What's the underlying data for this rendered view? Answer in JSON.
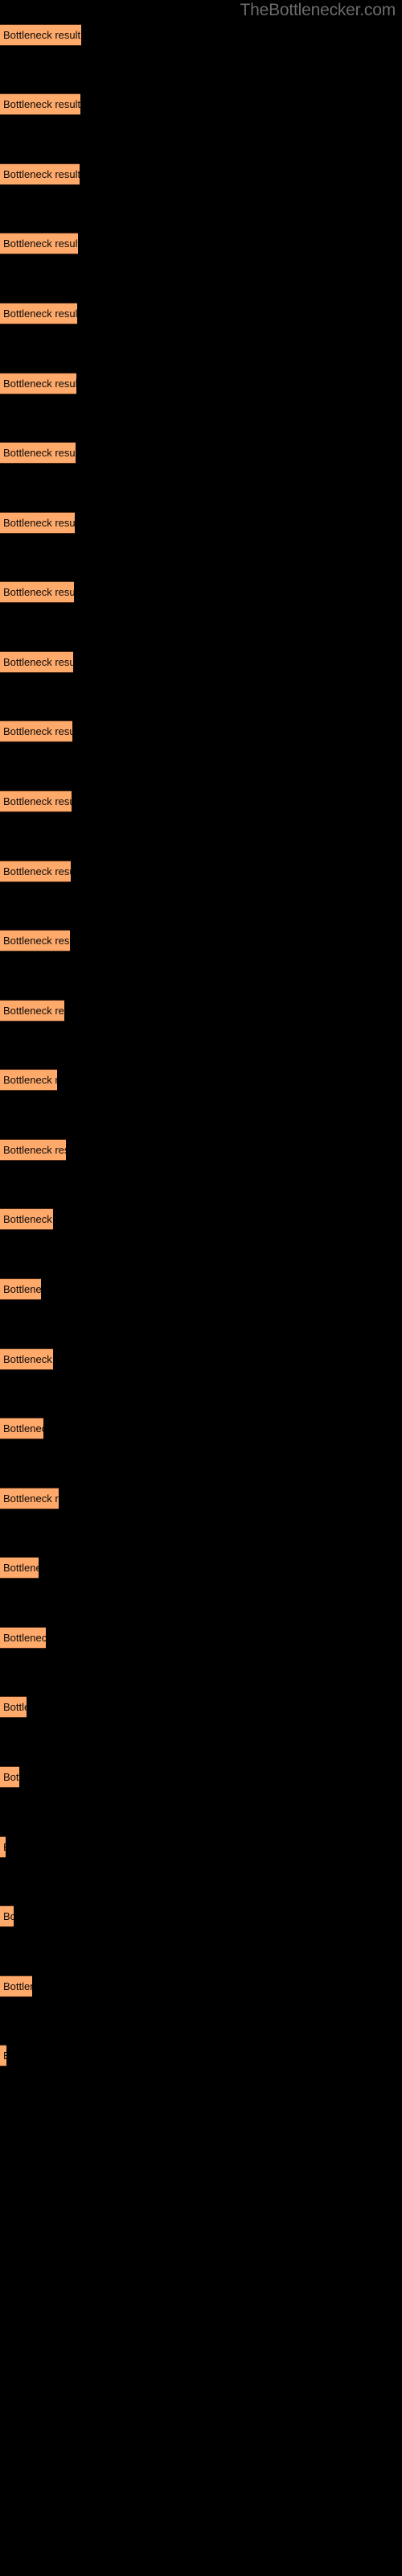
{
  "watermark": "TheBottlenecker.com",
  "colors": {
    "background": "#000000",
    "bar_fill": "#ffa96a",
    "bar_edge": "#4a2a16",
    "label_text": "#0a0a0a",
    "watermark_text": "#6b6b6b"
  },
  "chart_data": {
    "type": "bar",
    "orientation": "horizontal",
    "title": "",
    "subtitle": "",
    "xlabel": "",
    "ylabel": "",
    "grid": false,
    "legend": null,
    "bar_label_text": "Bottleneck result",
    "xlim": [
      0,
      500
    ],
    "categories": [
      "Bottleneck result",
      "Bottleneck result",
      "Bottleneck result",
      "Bottleneck result",
      "Bottleneck result",
      "Bottleneck result",
      "Bottleneck result",
      "Bottleneck result",
      "Bottleneck result",
      "Bottleneck result",
      "Bottleneck result",
      "Bottleneck result",
      "Bottleneck result",
      "Bottleneck result",
      "Bottleneck result",
      "Bottleneck result",
      "Bottleneck result",
      "Bottleneck result",
      "Bottleneck result",
      "Bottleneck result",
      "Bottleneck result",
      "Bottleneck result",
      "Bottleneck result",
      "Bottleneck result",
      "Bottleneck result",
      "Bottleneck result",
      "Bottleneck result",
      "Bottleneck result",
      "Bottleneck result",
      "Bottleneck result"
    ],
    "values": [
      101,
      100,
      99,
      97,
      96,
      95,
      94,
      93,
      92,
      91,
      90,
      89,
      88,
      87,
      80,
      71,
      82,
      66,
      51,
      66,
      54,
      73,
      48,
      57,
      33,
      24,
      7,
      17,
      40,
      8
    ],
    "bars": [
      {
        "label": "Bottleneck result",
        "value": 101,
        "y": 30
      },
      {
        "label": "Bottleneck result",
        "value": 100,
        "y": 116
      },
      {
        "label": "Bottleneck result",
        "value": 99,
        "y": 203
      },
      {
        "label": "Bottleneck result",
        "value": 97,
        "y": 289
      },
      {
        "label": "Bottleneck result",
        "value": 96,
        "y": 376
      },
      {
        "label": "Bottleneck result",
        "value": 95,
        "y": 463
      },
      {
        "label": "Bottleneck result",
        "value": 94,
        "y": 549
      },
      {
        "label": "Bottleneck result",
        "value": 93,
        "y": 636
      },
      {
        "label": "Bottleneck result",
        "value": 92,
        "y": 722
      },
      {
        "label": "Bottleneck result",
        "value": 91,
        "y": 809
      },
      {
        "label": "Bottleneck result",
        "value": 90,
        "y": 895
      },
      {
        "label": "Bottleneck result",
        "value": 89,
        "y": 982
      },
      {
        "label": "Bottleneck result",
        "value": 88,
        "y": 1069
      },
      {
        "label": "Bottleneck result",
        "value": 87,
        "y": 1155
      },
      {
        "label": "Bottleneck result",
        "value": 80,
        "y": 1242
      },
      {
        "label": "Bottleneck result",
        "value": 71,
        "y": 1328
      },
      {
        "label": "Bottleneck result",
        "value": 82,
        "y": 1415
      },
      {
        "label": "Bottleneck result",
        "value": 66,
        "y": 1501
      },
      {
        "label": "Bottleneck result",
        "value": 51,
        "y": 1588
      },
      {
        "label": "Bottleneck result",
        "value": 66,
        "y": 1675
      },
      {
        "label": "Bottleneck result",
        "value": 54,
        "y": 1761
      },
      {
        "label": "Bottleneck result",
        "value": 73,
        "y": 1848
      },
      {
        "label": "Bottleneck result",
        "value": 48,
        "y": 1934
      },
      {
        "label": "Bottleneck result",
        "value": 57,
        "y": 2021
      },
      {
        "label": "Bottleneck result",
        "value": 33,
        "y": 2107
      },
      {
        "label": "Bottleneck result",
        "value": 24,
        "y": 2194
      },
      {
        "label": "Bottleneck result",
        "value": 7,
        "y": 2281
      },
      {
        "label": "Bottleneck result",
        "value": 17,
        "y": 2367
      },
      {
        "label": "Bottleneck result",
        "value": 40,
        "y": 2454
      },
      {
        "label": "Bottleneck result",
        "value": 8,
        "y": 2540
      }
    ]
  }
}
